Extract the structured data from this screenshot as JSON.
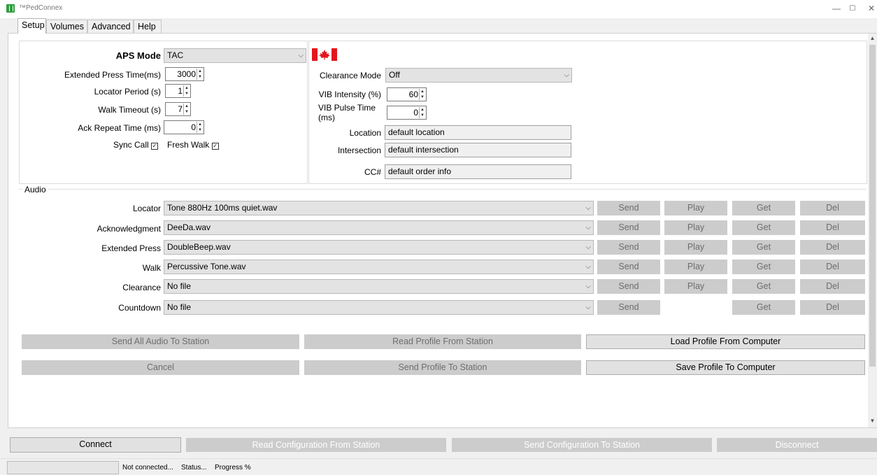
{
  "window": {
    "title": "™PedConnex",
    "controls": [
      "—",
      "▢",
      "✕"
    ]
  },
  "tabs": [
    {
      "label": "Setup",
      "active": true
    },
    {
      "label": "Volumes",
      "active": false
    },
    {
      "label": "Advanced",
      "active": false
    },
    {
      "label": "Help",
      "active": false
    }
  ],
  "setup": {
    "aps_mode": {
      "label": "APS Mode",
      "value": "TAC"
    },
    "extended_press_time": {
      "label": "Extended Press Time(ms)",
      "value": "3000"
    },
    "locator_period": {
      "label": "Locator Period (s)",
      "value": "1"
    },
    "walk_timeout": {
      "label": "Walk Timeout (s)",
      "value": "7"
    },
    "ack_repeat_time": {
      "label": "Ack Repeat Time (ms)",
      "value": "0"
    },
    "sync_call": {
      "label": "Sync Call",
      "checked": true
    },
    "fresh_walk": {
      "label": "Fresh Walk",
      "checked": true
    },
    "flag": "canada-flag",
    "clearance_mode": {
      "label": "Clearance Mode",
      "value": "Off"
    },
    "vib_intensity": {
      "label": "VIB Intensity (%)",
      "value": "60"
    },
    "vib_pulse_time": {
      "label_line1": "VIB Pulse Time",
      "label_line2": "(ms)",
      "value": "0"
    },
    "location": {
      "label": "Location",
      "value": "default location"
    },
    "intersection": {
      "label": "Intersection",
      "value": "default intersection"
    },
    "cc": {
      "label": "CC#",
      "value": "default order info"
    }
  },
  "audio": {
    "title": "Audio",
    "rows": [
      {
        "label": "Locator",
        "file": "Tone 880Hz 100ms quiet.wav",
        "has_play": true
      },
      {
        "label": "Acknowledgment",
        "file": "DeeDa.wav",
        "has_play": true
      },
      {
        "label": "Extended Press",
        "file": "DoubleBeep.wav",
        "has_play": true
      },
      {
        "label": "Walk",
        "file": "Percussive Tone.wav",
        "has_play": true
      },
      {
        "label": "Clearance",
        "file": "No file",
        "has_play": true
      },
      {
        "label": "Countdown",
        "file": "No file",
        "has_play": false
      }
    ],
    "buttons": {
      "send": "Send",
      "play": "Play",
      "get": "Get",
      "del": "Del"
    }
  },
  "profile_buttons": {
    "send_all_audio": "Send All Audio To Station",
    "read_profile": "Read Profile From Station",
    "load_profile": "Load Profile From Computer",
    "cancel": "Cancel",
    "send_profile": "Send Profile To Station",
    "save_profile": "Save Profile To Computer"
  },
  "bottom_buttons": {
    "connect": "Connect",
    "read_config": "Read Configuration From Station",
    "send_config": "Send Configuration To Station",
    "disconnect": "Disconnect"
  },
  "status": {
    "connection": "Not connected...",
    "status": "Status...",
    "progress": "Progress %"
  }
}
